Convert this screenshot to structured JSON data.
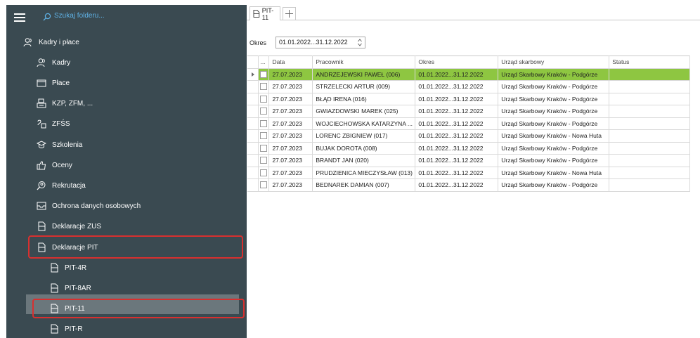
{
  "sidebar": {
    "search_placeholder": "Szukaj folderu...",
    "root_item": "Kadry i płace",
    "items": [
      {
        "label": "Kadry",
        "icon": "people-icon"
      },
      {
        "label": "Płace",
        "icon": "wallet-icon"
      },
      {
        "label": "KZP, ZFM, ...",
        "icon": "bank-icon"
      },
      {
        "label": "ZFŚS",
        "icon": "fund-icon"
      },
      {
        "label": "Szkolenia",
        "icon": "graduation-cap-icon"
      },
      {
        "label": "Oceny",
        "icon": "thumbs-up-icon"
      },
      {
        "label": "Rekrutacja",
        "icon": "person-search-icon"
      },
      {
        "label": "Ochrona danych osobowych",
        "icon": "inbox-icon"
      },
      {
        "label": "Deklaracje ZUS",
        "icon": "document-icon"
      },
      {
        "label": "Deklaracje PIT",
        "icon": "document-icon"
      }
    ],
    "sub_items": [
      {
        "label": "PIT-4R"
      },
      {
        "label": "PIT-8AR"
      },
      {
        "label": "PIT-11"
      },
      {
        "label": "PIT-R"
      }
    ],
    "highlight_color": "#d8302f"
  },
  "tabs": [
    {
      "label": "PIT-11"
    }
  ],
  "filter": {
    "label": "Okres",
    "value": "01.01.2022...31.12.2022"
  },
  "grid": {
    "columns": [
      "...",
      "Data",
      "Pracownik",
      "Okres",
      "Urząd skarbowy",
      "Status"
    ],
    "rows": [
      {
        "data": "27.07.2023",
        "pracownik": "ANDRZEJEWSKI PAWEŁ (006)",
        "okres": "01.01.2022...31.12.2022",
        "urzad": "Urząd Skarbowy Kraków - Podgórze",
        "status": ""
      },
      {
        "data": "27.07.2023",
        "pracownik": "STRZELECKI ARTUR (009)",
        "okres": "01.01.2022...31.12.2022",
        "urzad": "Urząd Skarbowy Kraków - Podgórze",
        "status": ""
      },
      {
        "data": "27.07.2023",
        "pracownik": "BŁĄD IRENA (016)",
        "okres": "01.01.2022...31.12.2022",
        "urzad": "Urząd Skarbowy Kraków - Podgórze",
        "status": ""
      },
      {
        "data": "27.07.2023",
        "pracownik": "GWIAZDOWSKI MAREK (025)",
        "okres": "01.01.2022...31.12.2022",
        "urzad": "Urząd Skarbowy Kraków - Podgórze",
        "status": ""
      },
      {
        "data": "27.07.2023",
        "pracownik": "WOJCIECHOWSKA KATARZYNA ...",
        "okres": "01.01.2022...31.12.2022",
        "urzad": "Urząd Skarbowy Kraków - Podgórze",
        "status": ""
      },
      {
        "data": "27.07.2023",
        "pracownik": "LORENC ZBIGNIEW (017)",
        "okres": "01.01.2022...31.12.2022",
        "urzad": "Urząd Skarbowy Kraków - Nowa Huta",
        "status": ""
      },
      {
        "data": "27.07.2023",
        "pracownik": "BUJAK DOROTA (008)",
        "okres": "01.01.2022...31.12.2022",
        "urzad": "Urząd Skarbowy Kraków - Podgórze",
        "status": ""
      },
      {
        "data": "27.07.2023",
        "pracownik": "BRANDT JAN (020)",
        "okres": "01.01.2022...31.12.2022",
        "urzad": "Urząd Skarbowy Kraków - Podgórze",
        "status": ""
      },
      {
        "data": "27.07.2023",
        "pracownik": "PRUDZIENICA MIECZYSŁAW (013)",
        "okres": "01.01.2022...31.12.2022",
        "urzad": "Urząd Skarbowy Kraków - Nowa Huta",
        "status": ""
      },
      {
        "data": "27.07.2023",
        "pracownik": "BEDNAREK DAMIAN (007)",
        "okres": "01.01.2022...31.12.2022",
        "urzad": "Urząd Skarbowy Kraków - Podgórze",
        "status": ""
      }
    ],
    "active_row_color": "#8ec641"
  }
}
